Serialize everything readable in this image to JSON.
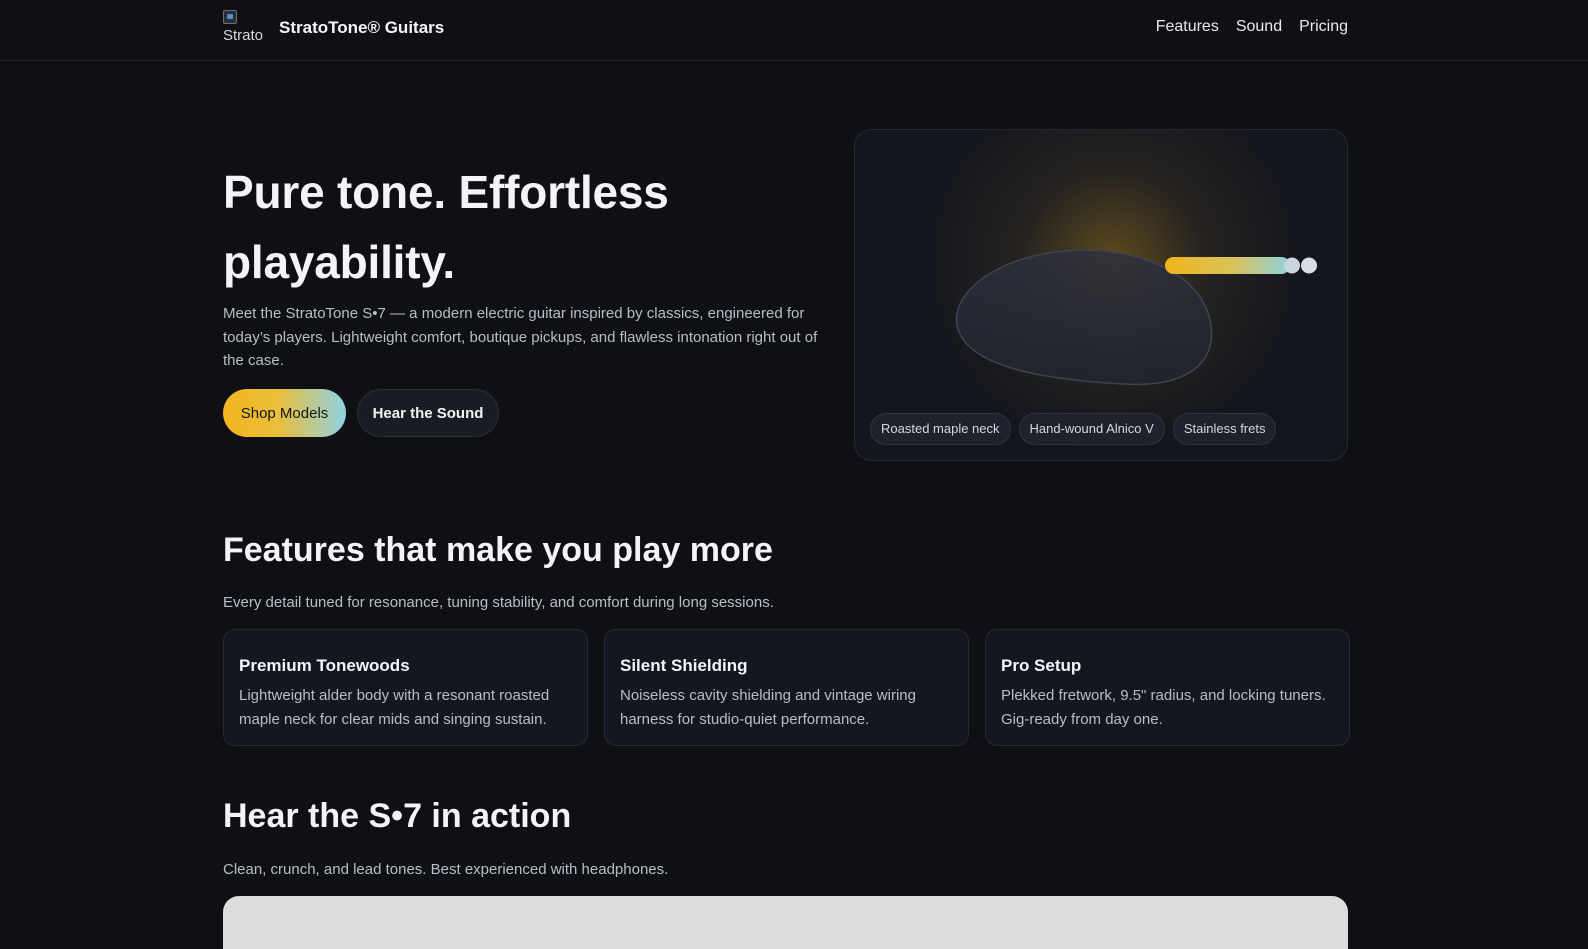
{
  "nav": {
    "logo_alt": "Strato",
    "brand": "StratoTone® Guitars",
    "links": [
      "Features",
      "Sound",
      "Pricing"
    ]
  },
  "hero": {
    "title": "Pure tone. Effortless playability.",
    "description": "Meet the StratoTone S•7 — a modern electric guitar inspired by classics, engineered for today’s players. Lightweight comfort, boutique pickups, and flawless intonation right out of the case.",
    "primary_button": "Shop Models",
    "secondary_button": "Hear the Sound",
    "chips": [
      "Roasted maple neck",
      "Hand-wound Alnico V",
      "Stainless frets"
    ]
  },
  "features": {
    "title": "Features that make you play more",
    "subtitle": "Every detail tuned for resonance, tuning stability, and comfort during long sessions.",
    "cards": [
      {
        "title": "Premium Tonewoods",
        "body": "Lightweight alder body with a resonant roasted maple neck for clear mids and singing sustain."
      },
      {
        "title": "Silent Shielding",
        "body": "Noiseless cavity shielding and vintage wiring harness for studio-quiet performance."
      },
      {
        "title": "Pro Setup",
        "body": "Plekked fretwork, 9.5\" radius, and locking tuners. Gig-ready from day one."
      }
    ]
  },
  "sound": {
    "title": "Hear the S•7 in action",
    "subtitle": "Clean, crunch, and lead tones. Best experienced with headphones."
  },
  "colors": {
    "background": "#0f1014",
    "accent_gold": "#f4b51f",
    "accent_cyan": "#8fd2e3"
  }
}
